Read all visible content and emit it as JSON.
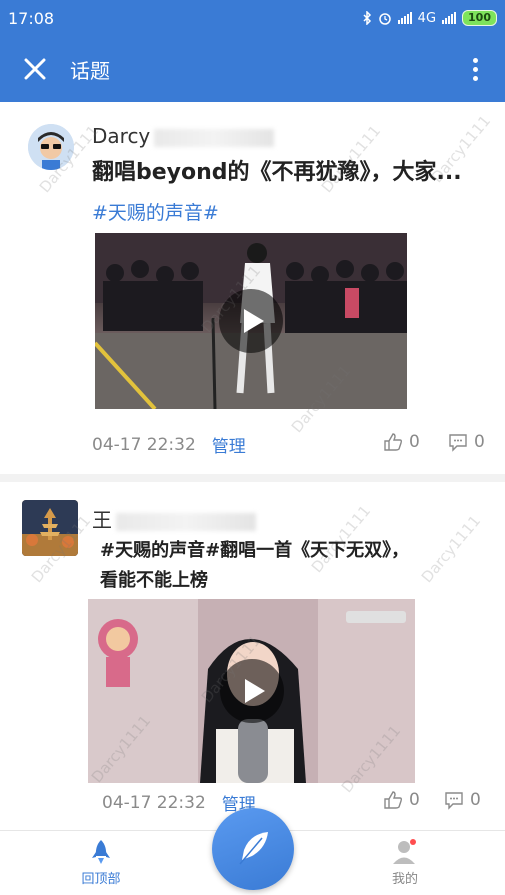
{
  "status_bar": {
    "time": "17:08",
    "network": "4G",
    "battery": "100"
  },
  "app_bar": {
    "title": "话题"
  },
  "posts": [
    {
      "author_visible": "Darcy",
      "headline": "翻唱beyond的《不再犹豫》，大家...",
      "tag": "#天赐的声音#",
      "time": "04-17 22:32",
      "manage": "管理",
      "likes": "0",
      "comments": "0"
    },
    {
      "author_visible": "王",
      "body": "#天赐的声音#翻唱一首《天下无双》，看能不能上榜",
      "time": "04-17 22:32",
      "manage": "管理",
      "likes": "0",
      "comments": "0"
    }
  ],
  "watermark": "Darcy1111",
  "bottom_nav": {
    "home_label": "回顶部",
    "me_label": "我的"
  },
  "colors": {
    "accent": "#3a7bd5",
    "battery": "#7ee35c",
    "notification_dot": "#ff4d4f"
  }
}
